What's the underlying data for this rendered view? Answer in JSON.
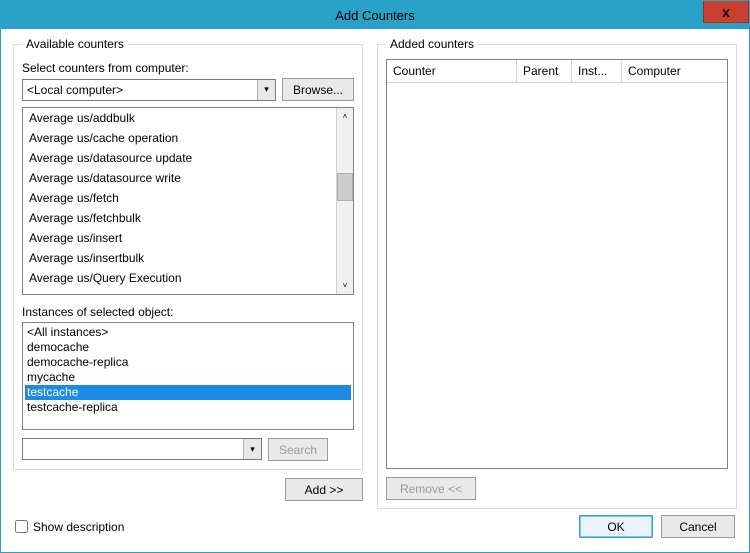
{
  "window": {
    "title": "Add Counters",
    "close_glyph": "x"
  },
  "left": {
    "groupbox_label": "Available counters",
    "select_label": "Select counters from computer:",
    "computer_value": "<Local computer>",
    "browse_label": "Browse...",
    "counters": [
      "Average us/addbulk",
      "Average us/cache operation",
      "Average us/datasource update",
      "Average us/datasource write",
      "Average us/fetch",
      "Average us/fetchbulk",
      "Average us/insert",
      "Average us/insertbulk",
      "Average us/Query Execution"
    ],
    "instances_label": "Instances of selected object:",
    "instances": [
      {
        "text": "<All instances>",
        "selected": false
      },
      {
        "text": "democache",
        "selected": false
      },
      {
        "text": "democache-replica",
        "selected": false
      },
      {
        "text": "mycache",
        "selected": false
      },
      {
        "text": "testcache",
        "selected": true
      },
      {
        "text": "testcache-replica",
        "selected": false
      }
    ],
    "search_value": "",
    "search_label": "Search",
    "add_label": "Add >>"
  },
  "right": {
    "groupbox_label": "Added counters",
    "columns": {
      "counter": "Counter",
      "parent": "Parent",
      "inst": "Inst...",
      "computer": "Computer"
    },
    "remove_label": "Remove <<"
  },
  "footer": {
    "show_desc_label": "Show description",
    "show_desc_checked": false,
    "ok_label": "OK",
    "cancel_label": "Cancel"
  },
  "glyphs": {
    "dropdown": "▾",
    "up": "˄",
    "down": "˅"
  }
}
